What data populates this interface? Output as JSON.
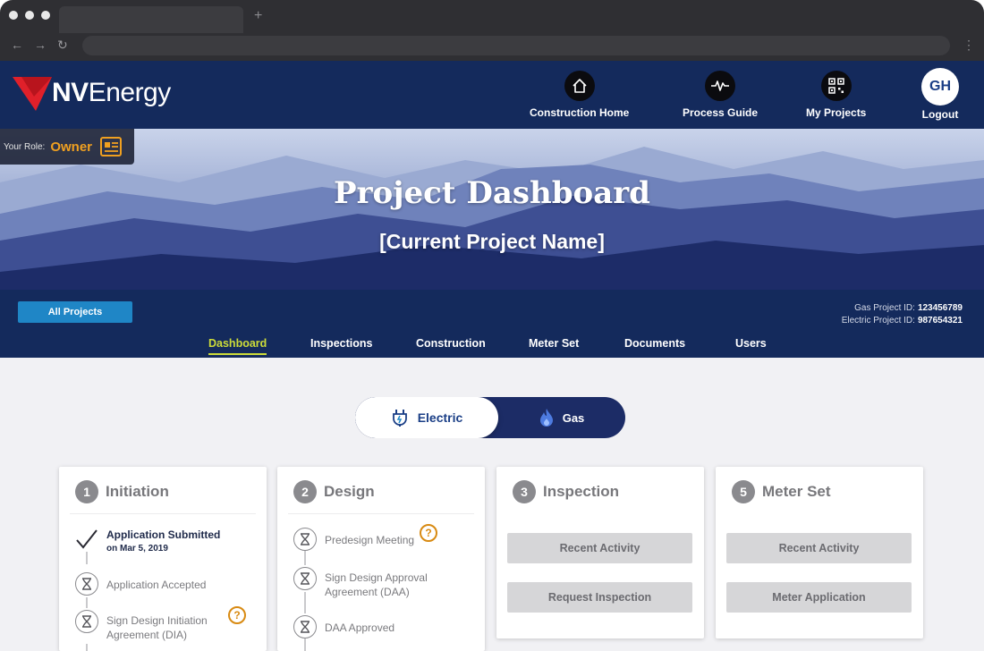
{
  "brand": {
    "name_bold": "NV",
    "name_rest": "Energy"
  },
  "nav": [
    {
      "label": "Construction Home",
      "icon": "home-icon"
    },
    {
      "label": "Process Guide",
      "icon": "pulse-icon"
    },
    {
      "label": "My Projects",
      "icon": "qr-code-icon"
    }
  ],
  "user": {
    "initials": "GH",
    "logout_label": "Logout"
  },
  "role": {
    "label": "Your Role:",
    "value": "Owner",
    "icon": "id-card-icon"
  },
  "hero": {
    "title": "Project Dashboard",
    "subtitle": "[Current Project Name]"
  },
  "projbar": {
    "all_projects_label": "All Projects",
    "gas_id_label": "Gas Project ID:",
    "gas_id_value": "123456789",
    "electric_id_label": "Electric Project ID:",
    "electric_id_value": "987654321"
  },
  "tabs": [
    {
      "label": "Dashboard",
      "active": true
    },
    {
      "label": "Inspections"
    },
    {
      "label": "Construction"
    },
    {
      "label": "Meter Set"
    },
    {
      "label": "Documents"
    },
    {
      "label": "Users"
    }
  ],
  "toggle": {
    "electric_label": "Electric",
    "gas_label": "Gas",
    "selected": "Electric"
  },
  "cards": {
    "initiation": {
      "number": "1",
      "title": "Initiation",
      "steps": [
        {
          "label": "Application Submitted",
          "date": "on Mar 5, 2019",
          "status": "complete"
        },
        {
          "label": "Application Accepted",
          "status": "pending"
        },
        {
          "label": "Sign Design Initiation Agreement (DIA)",
          "status": "pending",
          "help": "?"
        }
      ]
    },
    "design": {
      "number": "2",
      "title": "Design",
      "steps": [
        {
          "label": "Predesign Meeting",
          "status": "pending",
          "help": "?"
        },
        {
          "label": "Sign Design Approval Agreement (DAA)",
          "status": "pending"
        },
        {
          "label": "DAA Approved",
          "status": "pending"
        }
      ]
    },
    "inspection": {
      "number": "3",
      "title": "Inspection",
      "buttons": [
        "Recent Activity",
        "Request Inspection"
      ]
    },
    "meter_set": {
      "number": "5",
      "title": "Meter Set",
      "buttons": [
        "Recent Activity",
        "Meter Application"
      ]
    }
  },
  "colors": {
    "navy": "#142a5c",
    "accent_blue": "#1f86c6",
    "active_tab": "#cddc39",
    "role_orange": "#f0a020",
    "help_orange": "#d88a12"
  }
}
